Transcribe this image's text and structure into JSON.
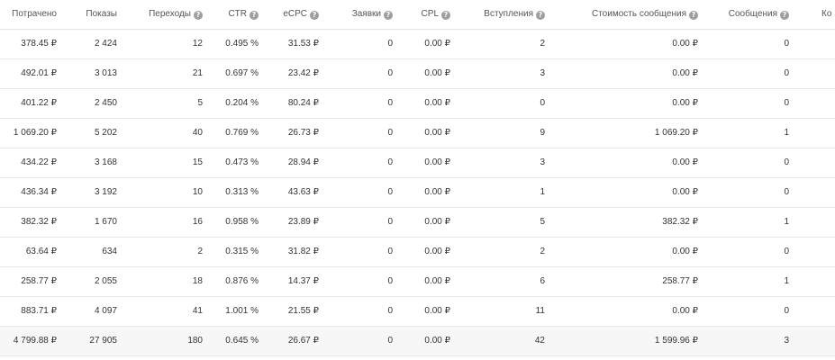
{
  "columns": [
    {
      "label": "Потрачено",
      "help": false
    },
    {
      "label": "Показы",
      "help": false
    },
    {
      "label": "Переходы",
      "help": true
    },
    {
      "label": "CTR",
      "help": true
    },
    {
      "label": "eCPC",
      "help": true
    },
    {
      "label": "Заявки",
      "help": true
    },
    {
      "label": "CPL",
      "help": true
    },
    {
      "label": "Вступления",
      "help": true
    },
    {
      "label": "Стоимость сообщения",
      "help": true
    },
    {
      "label": "Сообщения",
      "help": true
    },
    {
      "label": "Ко",
      "help": false
    }
  ],
  "help_glyph": "?",
  "rows": [
    [
      "378.45 ₽",
      "2 424",
      "12",
      "0.495 %",
      "31.53 ₽",
      "0",
      "0.00 ₽",
      "2",
      "0.00 ₽",
      "0"
    ],
    [
      "492.01 ₽",
      "3 013",
      "21",
      "0.697 %",
      "23.42 ₽",
      "0",
      "0.00 ₽",
      "3",
      "0.00 ₽",
      "0"
    ],
    [
      "401.22 ₽",
      "2 450",
      "5",
      "0.204 %",
      "80.24 ₽",
      "0",
      "0.00 ₽",
      "0",
      "0.00 ₽",
      "0"
    ],
    [
      "1 069.20 ₽",
      "5 202",
      "40",
      "0.769 %",
      "26.73 ₽",
      "0",
      "0.00 ₽",
      "9",
      "1 069.20 ₽",
      "1"
    ],
    [
      "434.22 ₽",
      "3 168",
      "15",
      "0.473 %",
      "28.94 ₽",
      "0",
      "0.00 ₽",
      "3",
      "0.00 ₽",
      "0"
    ],
    [
      "436.34 ₽",
      "3 192",
      "10",
      "0.313 %",
      "43.63 ₽",
      "0",
      "0.00 ₽",
      "1",
      "0.00 ₽",
      "0"
    ],
    [
      "382.32 ₽",
      "1 670",
      "16",
      "0.958 %",
      "23.89 ₽",
      "0",
      "0.00 ₽",
      "5",
      "382.32 ₽",
      "1"
    ],
    [
      "63.64 ₽",
      "634",
      "2",
      "0.315 %",
      "31.82 ₽",
      "0",
      "0.00 ₽",
      "2",
      "0.00 ₽",
      "0"
    ],
    [
      "258.77 ₽",
      "2 055",
      "18",
      "0.876 %",
      "14.37 ₽",
      "0",
      "0.00 ₽",
      "6",
      "258.77 ₽",
      "1"
    ],
    [
      "883.71 ₽",
      "4 097",
      "41",
      "1.001 %",
      "21.55 ₽",
      "0",
      "0.00 ₽",
      "11",
      "0.00 ₽",
      "0"
    ]
  ],
  "total": [
    "4 799.88 ₽",
    "27 905",
    "180",
    "0.645 %",
    "26.67 ₽",
    "0",
    "0.00 ₽",
    "42",
    "1 599.96 ₽",
    "3"
  ]
}
